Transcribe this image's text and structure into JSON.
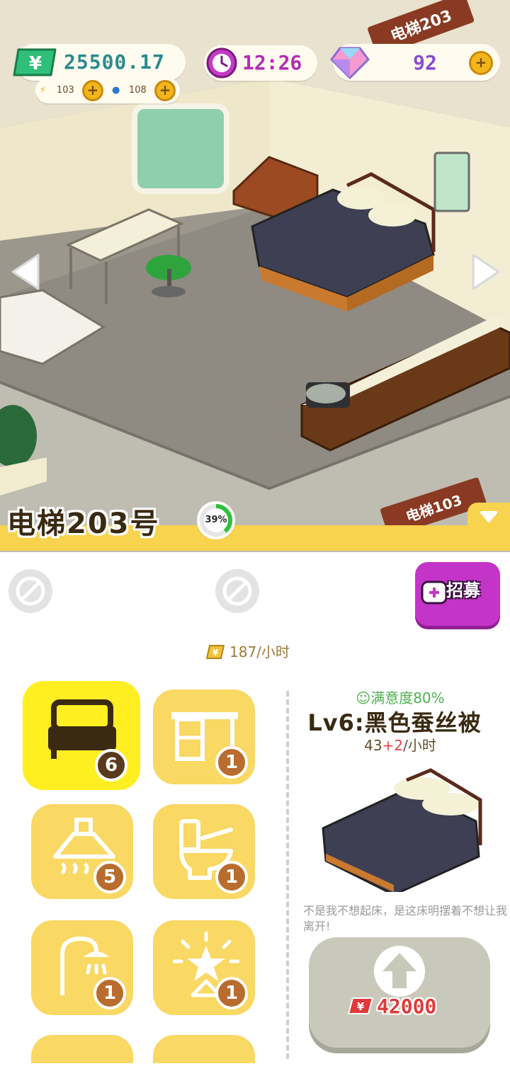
{
  "hud": {
    "money": "25500.17",
    "energy": "103",
    "water": "108",
    "time": "12:26",
    "gems": "92"
  },
  "scene": {
    "sign_top": "电梯203",
    "sign_bottom": "电梯103"
  },
  "room": {
    "title": "电梯203号",
    "progress_label": "39%",
    "progress_value": 0.39
  },
  "panel": {
    "recruit_label": "招募",
    "income": "187/小时",
    "categories": [
      {
        "icon": "bed-icon",
        "count": "6",
        "active": true
      },
      {
        "icon": "desk-icon",
        "count": "1",
        "active": false
      },
      {
        "icon": "range-hood-icon",
        "count": "5",
        "active": false
      },
      {
        "icon": "toilet-icon",
        "count": "1",
        "active": false
      },
      {
        "icon": "shower-icon",
        "count": "1",
        "active": false
      },
      {
        "icon": "decoration-icon",
        "count": "1",
        "active": false
      }
    ],
    "detail": {
      "satisfaction": "满意度80%",
      "name": "Lv6:黑色蚕丝被",
      "rate_base": "43",
      "rate_bonus": "+2",
      "rate_unit": "/小时",
      "description": "不是我不想起床，是这床明摆着不想让我离开!",
      "upgrade_cost": "42000"
    }
  },
  "colors": {
    "accent_yellow": "#f7d34e",
    "active_tile": "#ffee21",
    "recruit_purple": "#c534c9",
    "money_teal": "#2a8a8e",
    "time_purple": "#b42bb5",
    "cost_red": "#e23a3a"
  }
}
